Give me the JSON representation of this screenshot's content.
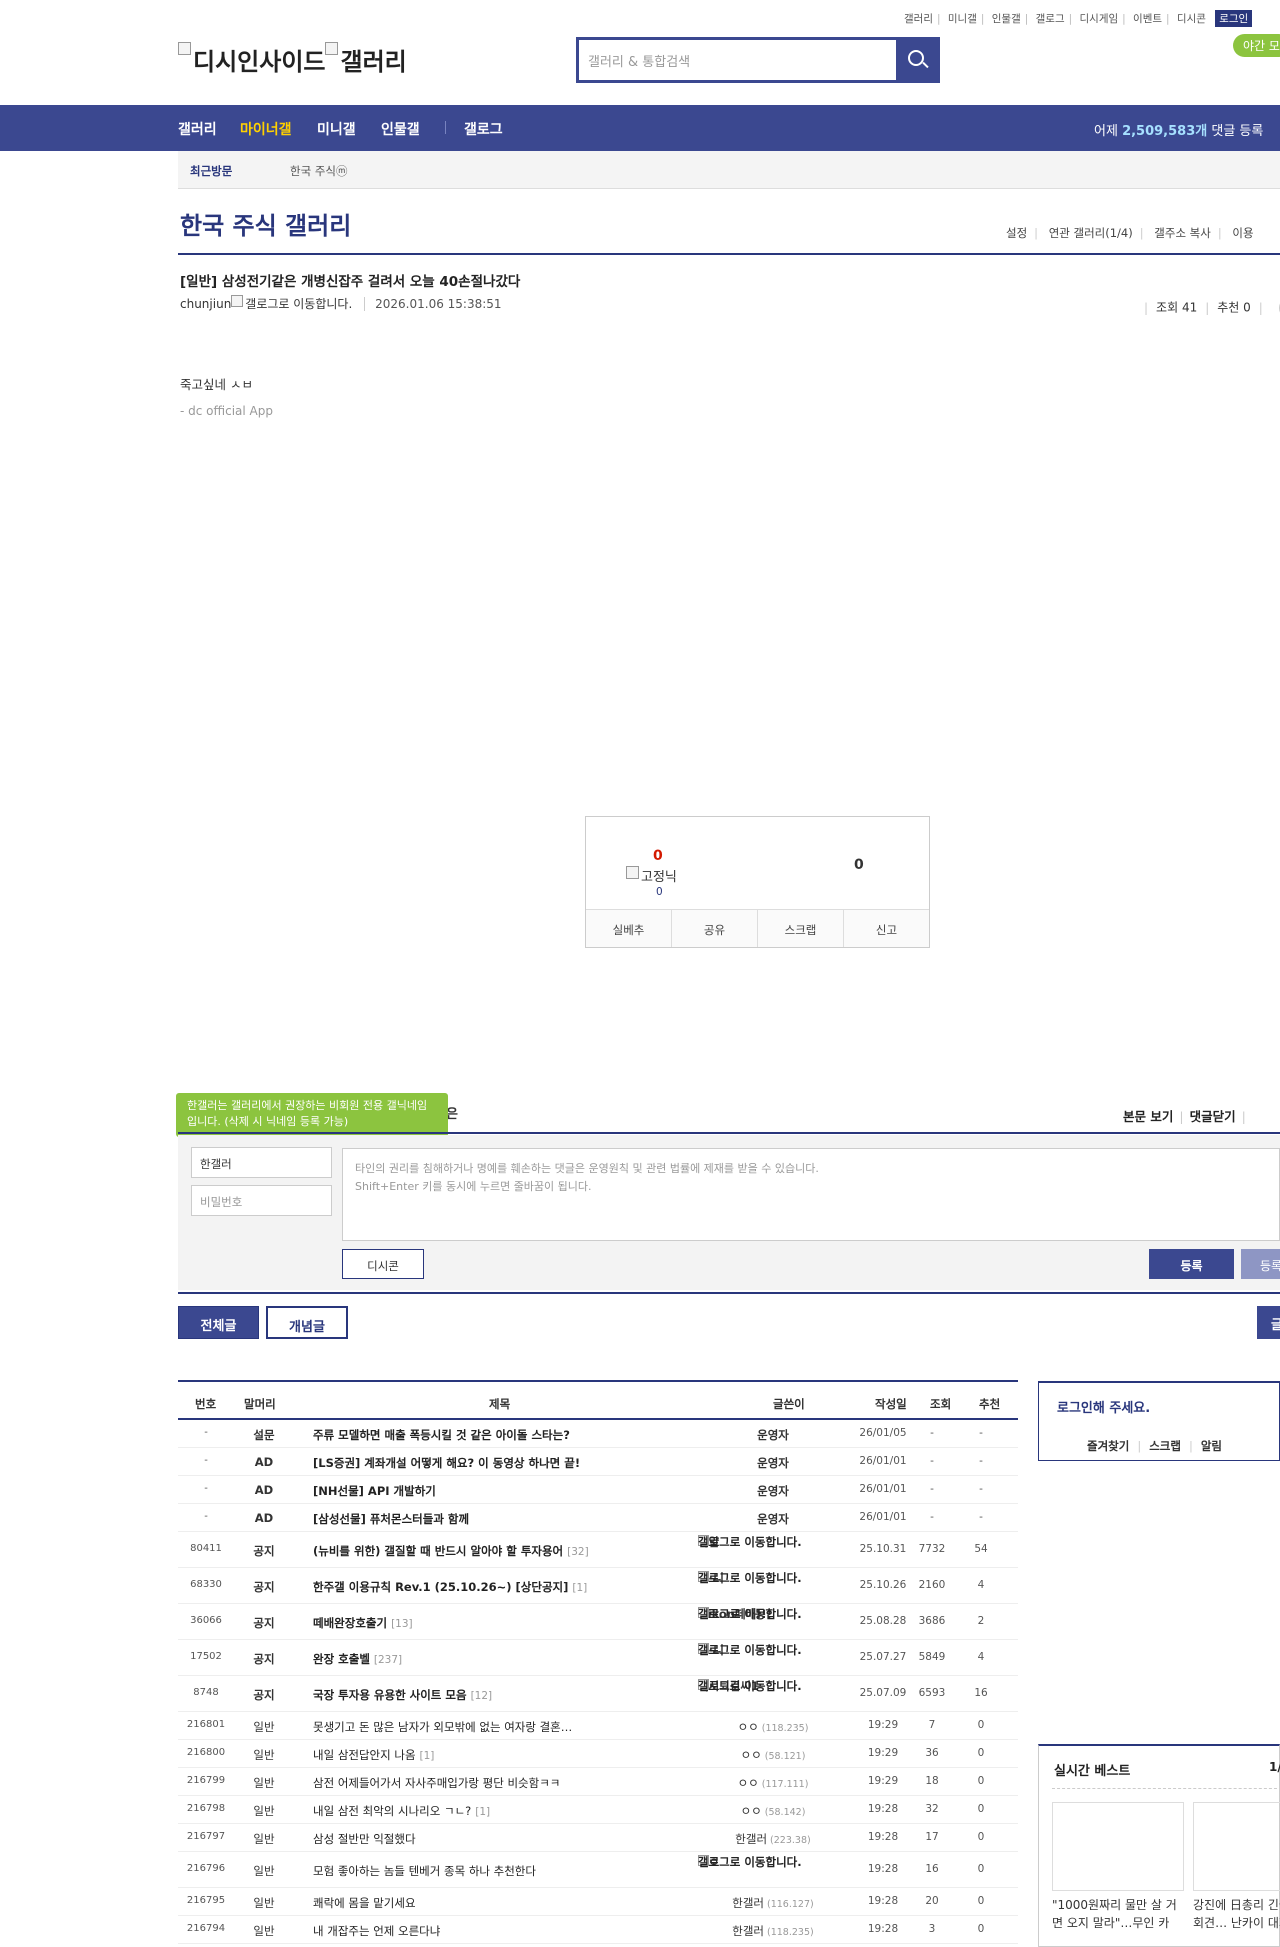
{
  "header": {
    "toplinks": [
      "갤러리",
      "미니갤",
      "인물갤",
      "갤로그",
      "디시게임",
      "이벤트",
      "디시콘"
    ],
    "login": "로그인",
    "night_mode": "야간 모",
    "logo_alt_1": "디시인사이드",
    "logo_alt_2": "갤러리",
    "search_placeholder": "갤러리 & 통합검색"
  },
  "nav": {
    "items": [
      "갤러리",
      "마이너갤",
      "미니갤",
      "인물갤",
      "갤로그"
    ],
    "active_index": 1,
    "stat_prefix": "어제",
    "stat_count": "2,509,583개",
    "stat_suffix": "댓글 등록"
  },
  "recent": {
    "label": "최근방문",
    "item": "한국 주식ⓜ"
  },
  "gallery": {
    "title": "한국 주식 갤러리",
    "tools": [
      "설정",
      "연관 갤러리(1/4)",
      "갤주소 복사",
      "이용"
    ]
  },
  "post": {
    "title": "[일반] 삼성전기같은 개병신잡주 걸려서 오늘 40손절나갔다",
    "writer": "chunjiun",
    "gallog_alt": "갤로그로 이동합니다.",
    "date": "2026.01.06 15:38:51",
    "views": "조회 41",
    "recommend": "추천 0",
    "body": "죽고싶네 ㅅㅂ",
    "source": "- dc official App"
  },
  "recommend_box": {
    "up": "0",
    "fixed_alt": "고정닉",
    "fixed_count": "0",
    "down": "0",
    "buttons": [
      "실베추",
      "공유",
      "스크랩",
      "신고"
    ]
  },
  "comment": {
    "tooltip": "한갤러는 갤러리에서 권장하는 비회원 전용 갤닉네임입니다. (삭제 시 닉네임 등록 가능)",
    "tooltip_tail": "은",
    "links": [
      "본문 보기",
      "댓글닫기"
    ],
    "nickname": "한갤러",
    "password_placeholder": "비밀번호",
    "textarea_line1": "타인의 권리를 침해하거나 명예를 훼손하는 댓글은 운영원칙 및 관련 법률에 제재를 받을 수 있습니다.",
    "textarea_line2": "Shift+Enter 키를 동시에 누르면 줄바꿈이 됩니다.",
    "dccon": "디시콘",
    "submit": "등록",
    "submit2": "등록"
  },
  "list_tabs": {
    "all": "전체글",
    "concept": "개념글",
    "right": "글"
  },
  "list": {
    "headers": {
      "num": "번호",
      "head": "말머리",
      "title": "제목",
      "writer": "글쓴이",
      "date": "작성일",
      "views": "조회",
      "rec": "추천"
    },
    "rows": [
      {
        "num": "-",
        "head": "설문",
        "title": "주류 모델하면 매출 폭등시킬 것 같은 아이돌 스타는?",
        "reply": "",
        "writer": "운영자",
        "ip": "",
        "date": "26/01/05",
        "views": "-",
        "rec": "-",
        "bold": true,
        "two_line": false
      },
      {
        "num": "-",
        "head": "AD",
        "title": "[LS증권] 계좌개설 어떻게 해요? 이 동영상 하나면 끝!",
        "reply": "",
        "writer": "운영자",
        "ip": "",
        "date": "26/01/01",
        "views": "-",
        "rec": "-",
        "bold": true,
        "two_line": false
      },
      {
        "num": "-",
        "head": "AD",
        "title": "[NH선물] API 개발하기",
        "reply": "",
        "writer": "운영자",
        "ip": "",
        "date": "26/01/01",
        "views": "-",
        "rec": "-",
        "bold": true,
        "two_line": false
      },
      {
        "num": "-",
        "head": "AD",
        "title": "[삼성선물] 퓨처몬스터들과 함께",
        "reply": "",
        "writer": "운영자",
        "ip": "",
        "date": "26/01/01",
        "views": "-",
        "rec": "-",
        "bold": true,
        "two_line": false
      },
      {
        "num": "80411",
        "head": "공지",
        "title": "(뉴비를 위한) 갤질할 때 반드시 알아야 할 투자용어",
        "reply": "[32]",
        "writer": "가얄",
        "ip": "",
        "date": "25.10.31",
        "views": "7732",
        "rec": "54",
        "bold": true,
        "two_line": true
      },
      {
        "num": "68330",
        "head": "공지",
        "title": "한주갤 이용규칙 Rev.1 (25.10.26~) [상단공지]",
        "reply": "[1]",
        "writer": "고-니",
        "ip": "",
        "date": "25.10.26",
        "views": "2160",
        "rec": "4",
        "bold": true,
        "two_line": true
      },
      {
        "num": "36066",
        "head": "공지",
        "title": "떼배완장호출기",
        "reply": "[13]",
        "writer": "Nikon떼배!!!",
        "ip": "",
        "date": "25.08.28",
        "views": "3686",
        "rec": "2",
        "bold": true,
        "two_line": true
      },
      {
        "num": "17502",
        "head": "공지",
        "title": "완장 호출벨",
        "reply": "[237]",
        "writer": "고-니",
        "ip": "",
        "date": "25.07.27",
        "views": "5849",
        "rec": "4",
        "bold": true,
        "two_line": true
      },
      {
        "num": "8748",
        "head": "공지",
        "title": "국장 투자용 유용한 사이트 모음",
        "reply": "[12]",
        "writer": "거시퇴김씨1",
        "ip": "",
        "date": "25.07.09",
        "views": "6593",
        "rec": "16",
        "bold": true,
        "two_line": true
      },
      {
        "num": "216801",
        "head": "일반",
        "title": "못생기고 돈 많은 남자가 외모밖에 없는 여자랑 결혼…",
        "reply": "",
        "writer": "ㅇㅇ",
        "ip": "(118.235)",
        "date": "19:29",
        "views": "7",
        "rec": "0",
        "bold": false,
        "two_line": false
      },
      {
        "num": "216800",
        "head": "일반",
        "title": "내일 삼전답안지 나옴",
        "reply": "[1]",
        "writer": "ㅇㅇ",
        "ip": "(58.121)",
        "date": "19:29",
        "views": "36",
        "rec": "0",
        "bold": false,
        "two_line": false
      },
      {
        "num": "216799",
        "head": "일반",
        "title": "삼전 어제들어가서 자사주매입가랑 평단 비슷함ㅋㅋ",
        "reply": "",
        "writer": "ㅇㅇ",
        "ip": "(117.111)",
        "date": "19:29",
        "views": "18",
        "rec": "0",
        "bold": false,
        "two_line": false
      },
      {
        "num": "216798",
        "head": "일반",
        "title": "내일 삼전 최악의 시나리오 ㄱㄴ?",
        "reply": "[1]",
        "writer": "ㅇㅇ",
        "ip": "(58.142)",
        "date": "19:28",
        "views": "32",
        "rec": "0",
        "bold": false,
        "two_line": false
      },
      {
        "num": "216797",
        "head": "일반",
        "title": "삼성 절반만 익절했다",
        "reply": "",
        "writer": "한갤러",
        "ip": "(223.38)",
        "date": "19:28",
        "views": "17",
        "rec": "0",
        "bold": false,
        "two_line": false
      },
      {
        "num": "216796",
        "head": "일반",
        "title": "모험 좋아하는 놈들 텐베거 종목 하나 추천한다",
        "reply": "",
        "writer": "ㅇㅇ",
        "ip": "",
        "date": "19:28",
        "views": "16",
        "rec": "0",
        "bold": false,
        "two_line": true
      },
      {
        "num": "216795",
        "head": "일반",
        "title": "쾌락에 몸을 맡기세요",
        "reply": "",
        "writer": "한갤러",
        "ip": "(116.127)",
        "date": "19:28",
        "views": "20",
        "rec": "0",
        "bold": false,
        "two_line": false
      },
      {
        "num": "216794",
        "head": "일반",
        "title": "내 개잡주는 언제 오른다냐",
        "reply": "",
        "writer": "한갤러",
        "ip": "(118.235)",
        "date": "19:28",
        "views": "3",
        "rec": "0",
        "bold": false,
        "two_line": false
      }
    ]
  },
  "side_login": {
    "title": "로그인해 주세요.",
    "links": [
      "즐겨찾기",
      "스크랩",
      "알림"
    ]
  },
  "best": {
    "title": "실시간 베스트",
    "page": "1/",
    "items": [
      "\"1000원짜리 물만 살 거면 오지 말라\"…무인 카",
      "강진에 日총리 긴급 회견… 난카이 대지"
    ]
  },
  "colors": {
    "brand": "#3b4890",
    "brand_dark": "#29367c",
    "accent_yellow": "#ffd100",
    "green": "#8cc43f",
    "red": "#d31900"
  }
}
